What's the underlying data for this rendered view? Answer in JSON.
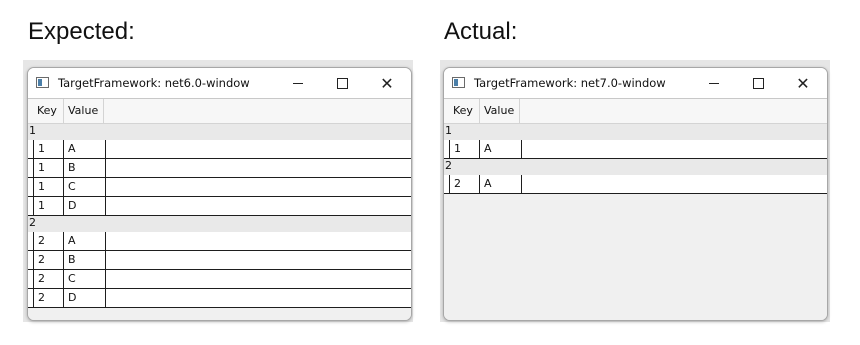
{
  "expected": {
    "heading": "Expected:",
    "window_title": "TargetFramework: net6.0-window",
    "columns": [
      "Key",
      "Value"
    ],
    "groups": [
      {
        "label": "1",
        "rows": [
          {
            "key": "1",
            "value": "A"
          },
          {
            "key": "1",
            "value": "B"
          },
          {
            "key": "1",
            "value": "C"
          },
          {
            "key": "1",
            "value": "D"
          }
        ]
      },
      {
        "label": "2",
        "rows": [
          {
            "key": "2",
            "value": "A"
          },
          {
            "key": "2",
            "value": "B"
          },
          {
            "key": "2",
            "value": "C"
          },
          {
            "key": "2",
            "value": "D"
          }
        ]
      }
    ]
  },
  "actual": {
    "heading": "Actual:",
    "window_title": "TargetFramework: net7.0-window",
    "columns": [
      "Key",
      "Value"
    ],
    "groups": [
      {
        "label": "1",
        "rows": [
          {
            "key": "1",
            "value": "A"
          }
        ]
      },
      {
        "label": "2",
        "rows": [
          {
            "key": "2",
            "value": "A"
          }
        ]
      }
    ]
  },
  "window_controls": {
    "close_glyph": "✕"
  },
  "icons": {
    "app": "app-window-icon",
    "minimize": "minimize-icon",
    "maximize": "maximize-icon",
    "close": "close-icon"
  }
}
